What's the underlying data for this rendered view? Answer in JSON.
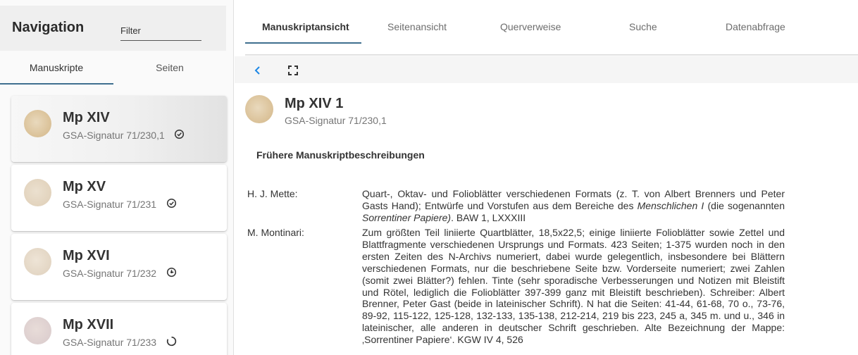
{
  "sidebar": {
    "title": "Navigation",
    "filter_placeholder": "Filter",
    "tabs": [
      {
        "label": "Manuskripte"
      },
      {
        "label": "Seiten"
      }
    ],
    "manuscripts": [
      {
        "name": "Mp XIV",
        "signature": "GSA-Signatur 71/230,1",
        "status_icon": "check-circle-icon"
      },
      {
        "name": "Mp XV",
        "signature": "GSA-Signatur 71/231",
        "status_icon": "check-circle-icon"
      },
      {
        "name": "Mp XVI",
        "signature": "GSA-Signatur 71/232",
        "status_icon": "progress-circle-icon"
      },
      {
        "name": "Mp XVII",
        "signature": "GSA-Signatur 71/233",
        "status_icon": "loading-circle-icon"
      }
    ]
  },
  "main": {
    "tabs": [
      {
        "label": "Manuskriptansicht"
      },
      {
        "label": "Seitenansicht"
      },
      {
        "label": "Querverweise"
      },
      {
        "label": "Suche"
      },
      {
        "label": "Datenabfrage"
      }
    ],
    "toolbar": {
      "back_icon": "chevron-left-icon",
      "fullscreen_icon": "fullscreen-icon"
    },
    "manuscript": {
      "title": "Mp XIV 1",
      "signature": "GSA-Signatur 71/230,1"
    },
    "section_title": "Frühere Manuskriptbeschreibungen",
    "descriptions": [
      {
        "author": "H. J. Mette:",
        "text_before": "Quart-, Oktav- und Folioblätter verschiedenen Formats (z. T. von Albert Brenners und Peter Gasts Hand); Entwürfe und Vorstufen aus dem Bereiche des ",
        "italic_1": "Menschlichen I",
        "text_mid": " (die sogenannten ",
        "italic_2": "Sorrentiner Papiere)",
        "text_after": ". BAW 1, LXXXIII"
      },
      {
        "author": "M. Montinari:",
        "text": "Zum größten Teil liniierte Quartblätter, 18,5x22,5; einige liniierte Folioblätter sowie Zettel und Blattfragmente verschiedenen Ursprungs und Formats. 423 Seiten; 1-375 wurden noch in den ersten Zeiten des N-Archivs numeriert, dabei wurde gelegentlich, insbesondere bei Blättern verschiedenen Formats, nur die beschriebene Seite bzw. Vorderseite numeriert; zwei Zahlen (somit zwei Blätter?) fehlen. Tinte (sehr sporadische Verbesserungen und Notizen mit Bleistift und Rötel, lediglich die Folioblätter 397-399 ganz mit Bleistift beschrieben). Schreiber: Albert Brenner, Peter Gast (beide in lateinischer Schrift). N hat die Seiten: 41-44, 61-68, 70 o., 73-76, 89-92, 115-122, 125-128, 132-133, 135-138, 212-214, 219 bis 223, 245 a, 345 m. und u., 346 in lateinischer, alle anderen in deutscher Schrift geschrieben. Alte Bezeichnung der Mappe: ‚Sorrentiner Papiere‘. KGW IV 4, 526"
      }
    ]
  },
  "colors": {
    "accent": "#3f6f8f",
    "back_icon": "#1e88e5"
  }
}
